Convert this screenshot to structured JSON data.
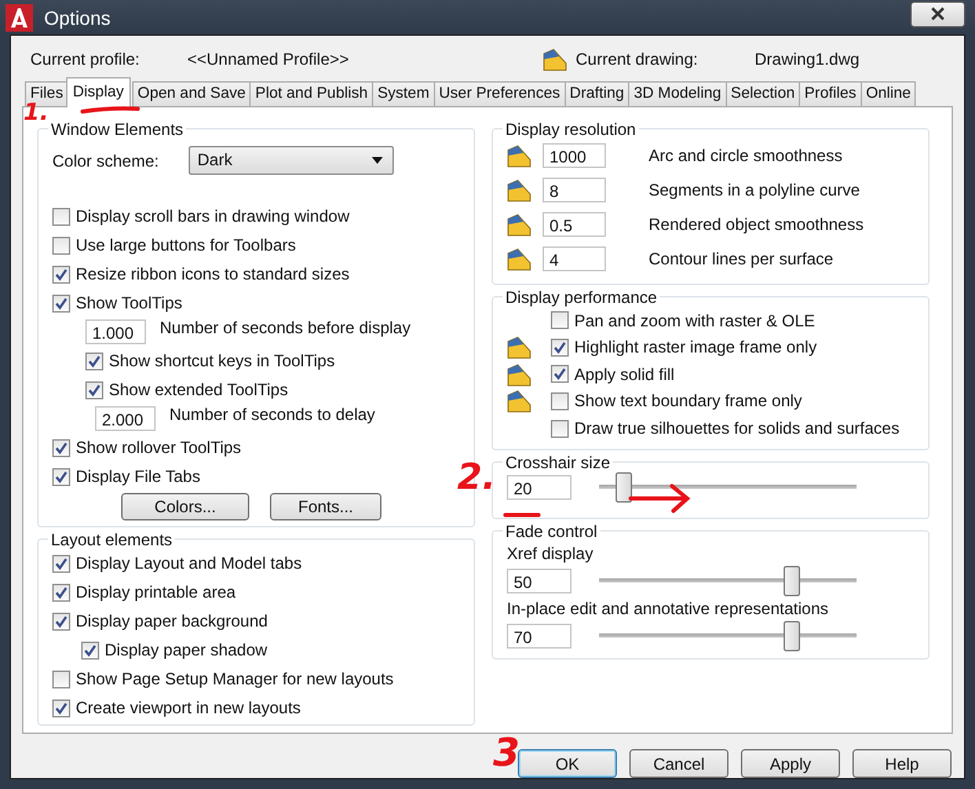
{
  "window": {
    "title": "Options"
  },
  "profile": {
    "label": "Current profile:",
    "value": "<<Unnamed Profile>>",
    "drawing_label": "Current drawing:",
    "drawing_value": "Drawing1.dwg"
  },
  "tabs": [
    {
      "label": "Files",
      "selected": false
    },
    {
      "label": "Display",
      "selected": true
    },
    {
      "label": "Open and Save",
      "selected": false
    },
    {
      "label": "Plot and Publish",
      "selected": false
    },
    {
      "label": "System",
      "selected": false
    },
    {
      "label": "User Preferences",
      "selected": false
    },
    {
      "label": "Drafting",
      "selected": false
    },
    {
      "label": "3D Modeling",
      "selected": false
    },
    {
      "label": "Selection",
      "selected": false
    },
    {
      "label": "Profiles",
      "selected": false
    },
    {
      "label": "Online",
      "selected": false
    }
  ],
  "window_elements": {
    "title": "Window Elements",
    "color_scheme": {
      "label": "Color scheme:",
      "value": "Dark"
    },
    "options": [
      {
        "kind": "checkbox",
        "label": "Display scroll bars in drawing window",
        "checked": false
      },
      {
        "kind": "checkbox",
        "label": "Use large buttons for Toolbars",
        "checked": false
      },
      {
        "kind": "checkbox",
        "label": "Resize ribbon icons to standard sizes",
        "checked": true
      },
      {
        "kind": "checkbox",
        "label": "Show ToolTips",
        "checked": true,
        "children": [
          {
            "kind": "number",
            "value": "1.000",
            "label": "Number of seconds before display"
          },
          {
            "kind": "checkbox",
            "label": "Show shortcut keys in ToolTips",
            "checked": true
          },
          {
            "kind": "checkbox",
            "label": "Show extended ToolTips",
            "checked": true,
            "children": [
              {
                "kind": "number",
                "value": "2.000",
                "label": "Number of seconds to delay"
              }
            ]
          }
        ]
      },
      {
        "kind": "checkbox",
        "label": "Show rollover ToolTips",
        "checked": true
      },
      {
        "kind": "checkbox",
        "label": "Display File Tabs",
        "checked": true
      }
    ],
    "buttons": [
      "Colors...",
      "Fonts..."
    ]
  },
  "layout_elements": {
    "title": "Layout elements",
    "options": [
      {
        "kind": "checkbox",
        "label": "Display Layout and Model tabs",
        "checked": true
      },
      {
        "kind": "checkbox",
        "label": "Display printable area",
        "checked": true
      },
      {
        "kind": "checkbox",
        "label": "Display paper background",
        "checked": true,
        "children": [
          {
            "kind": "checkbox",
            "label": "Display paper shadow",
            "checked": true
          }
        ]
      },
      {
        "kind": "checkbox",
        "label": "Show Page Setup Manager for new layouts",
        "checked": false
      },
      {
        "kind": "checkbox",
        "label": "Create viewport in new layouts",
        "checked": true
      }
    ]
  },
  "display_resolution": {
    "title": "Display resolution",
    "rows": [
      {
        "value": "1000",
        "label": "Arc and circle smoothness",
        "drawing_icon": true
      },
      {
        "value": "8",
        "label": "Segments in a polyline curve",
        "drawing_icon": true
      },
      {
        "value": "0.5",
        "label": "Rendered object smoothness",
        "drawing_icon": true
      },
      {
        "value": "4",
        "label": "Contour lines per surface",
        "drawing_icon": true
      }
    ]
  },
  "display_performance": {
    "title": "Display performance",
    "options": [
      {
        "label": "Pan and zoom with raster & OLE",
        "checked": false,
        "drawing_icon": false
      },
      {
        "label": "Highlight raster image frame only",
        "checked": true,
        "drawing_icon": true
      },
      {
        "label": "Apply solid fill",
        "checked": true,
        "drawing_icon": true
      },
      {
        "label": "Show text boundary frame only",
        "checked": false,
        "drawing_icon": true
      },
      {
        "label": "Draw true silhouettes for solids and surfaces",
        "checked": false,
        "drawing_icon": false
      }
    ]
  },
  "crosshair": {
    "title": "Crosshair size",
    "value": "20",
    "level": 0.07
  },
  "fade_control": {
    "title": "Fade control",
    "sliders": [
      {
        "label": "Xref display",
        "value": "50",
        "level": 0.76
      },
      {
        "label": "In-place edit and annotative representations",
        "value": "70",
        "level": 0.76
      }
    ]
  },
  "buttons": [
    {
      "label": "OK",
      "default": true
    },
    {
      "label": "Cancel",
      "default": false
    },
    {
      "label": "Apply",
      "default": false
    },
    {
      "label": "Help",
      "default": false
    }
  ],
  "annotations": [
    {
      "text": "1."
    },
    {
      "text": "2."
    },
    {
      "text": "3"
    }
  ]
}
